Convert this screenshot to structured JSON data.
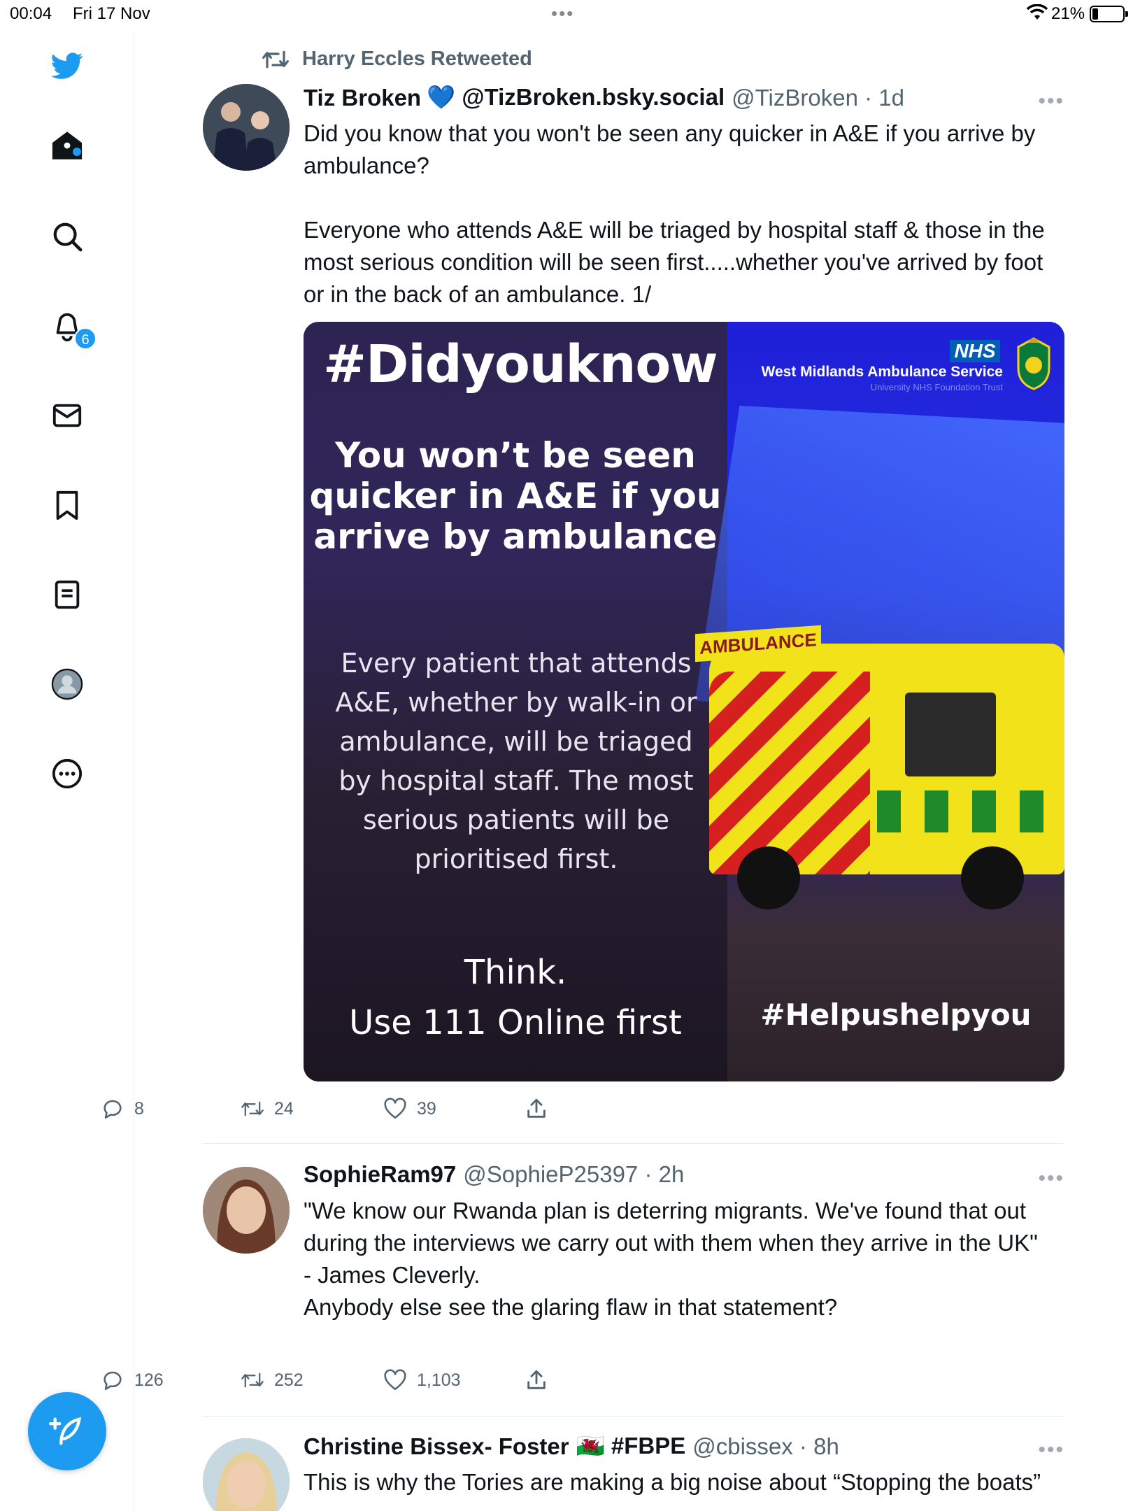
{
  "status_bar": {
    "time": "00:04",
    "date": "Fri 17 Nov",
    "battery": "21%"
  },
  "sidebar": {
    "notification_count": "6",
    "items": [
      {
        "name": "twitter-logo-icon"
      },
      {
        "name": "home-icon"
      },
      {
        "name": "search-icon"
      },
      {
        "name": "notifications-bell-icon"
      },
      {
        "name": "messages-envelope-icon"
      },
      {
        "name": "bookmark-icon"
      },
      {
        "name": "lists-icon"
      },
      {
        "name": "profile-avatar-icon"
      },
      {
        "name": "more-circle-icon"
      }
    ],
    "compose_icon": "compose-feather-icon"
  },
  "colors": {
    "accent": "#1d9bf0",
    "secondary_text": "#536471"
  },
  "timeline": {
    "tweet1": {
      "retweeted_by": "Harry Eccles Retweeted",
      "name": "Tiz Broken",
      "name_suffix": "💙 @TizBroken.bsky.social",
      "handle": "@TizBroken · 1d",
      "text": "Did you know that you won't be seen any quicker in A&E if you arrive by ambulance?\n\nEveryone who attends A&E will be triaged by hospital staff & those in the most serious condition will be seen first.....whether you've arrived by foot or in the back of an ambulance. 1/",
      "media": {
        "hashtag": "#Didyouknow",
        "headline": "You won’t be seen quicker in A&E if you arrive by ambulance",
        "paragraph": "Every patient that attends A&E, whether by walk-in or ambulance, will be triaged by hospital staff. The most serious patients will be prioritised first.",
        "think": "Think.",
        "use111": "Use 111 Online first",
        "helpus": "#Helpushelpyou",
        "nhs": "NHS",
        "service": "West Midlands Ambulance Service",
        "trust": "University NHS Foundation Trust",
        "van_sign": "AMBULANCE"
      },
      "replies": "8",
      "retweets": "24",
      "likes": "39"
    },
    "tweet2": {
      "name": "SophieRam97",
      "handle": "@SophieP25397 · 2h",
      "text": "\"We know our Rwanda plan is deterring migrants. We've found that out during the interviews we carry out with them when they arrive in the UK\"\n- James Cleverly.\nAnybody else see the glaring flaw in that statement?",
      "replies": "126",
      "retweets": "252",
      "likes": "1,103"
    },
    "tweet3": {
      "name": "Christine Bissex- Foster",
      "name_suffix": "🏴󠁧󠁢󠁷󠁬󠁳󠁿 #FBPE",
      "handle": "@cbissex · 8h",
      "text": "This is why the Tories are making a big noise about “Stopping the boats”"
    }
  }
}
